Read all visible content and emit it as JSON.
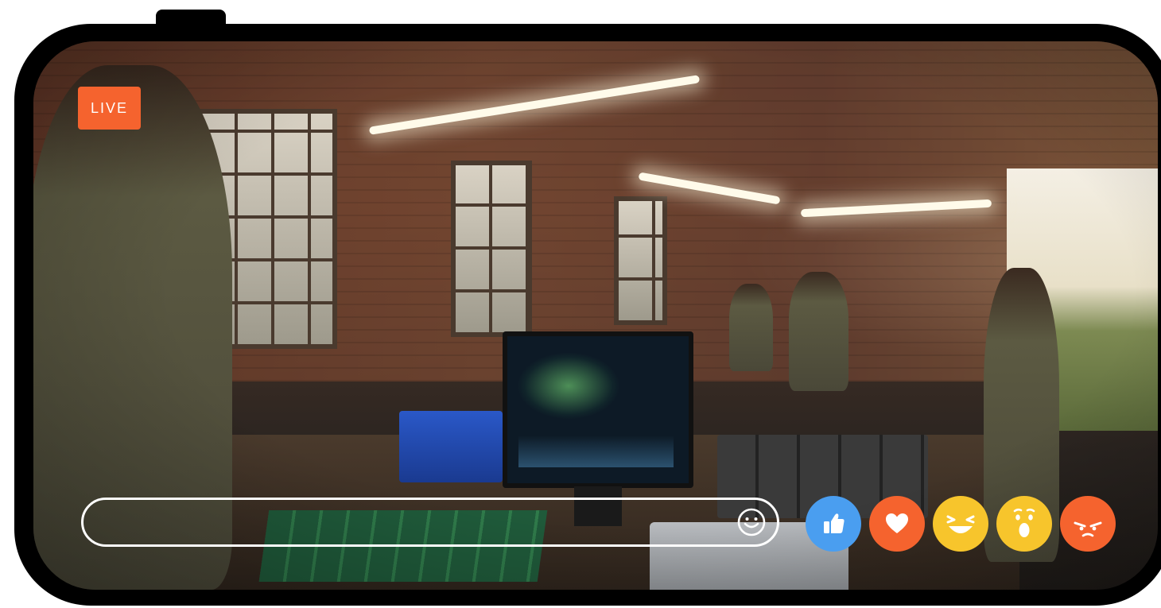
{
  "live_badge": {
    "label": "LIVE",
    "color": "#f5632e"
  },
  "comment_bar": {
    "placeholder": "",
    "emoji_icon": "smiley-icon"
  },
  "reactions": [
    {
      "name": "like",
      "icon": "thumbs-up-icon",
      "color": "#4a9ef0"
    },
    {
      "name": "love",
      "icon": "heart-icon",
      "color": "#f5632e"
    },
    {
      "name": "haha",
      "icon": "laughing-face-icon",
      "color": "#f7c52c"
    },
    {
      "name": "wow",
      "icon": "surprised-face-icon",
      "color": "#f7c52c"
    },
    {
      "name": "angry",
      "icon": "angry-face-icon",
      "color": "#f5632e"
    }
  ]
}
